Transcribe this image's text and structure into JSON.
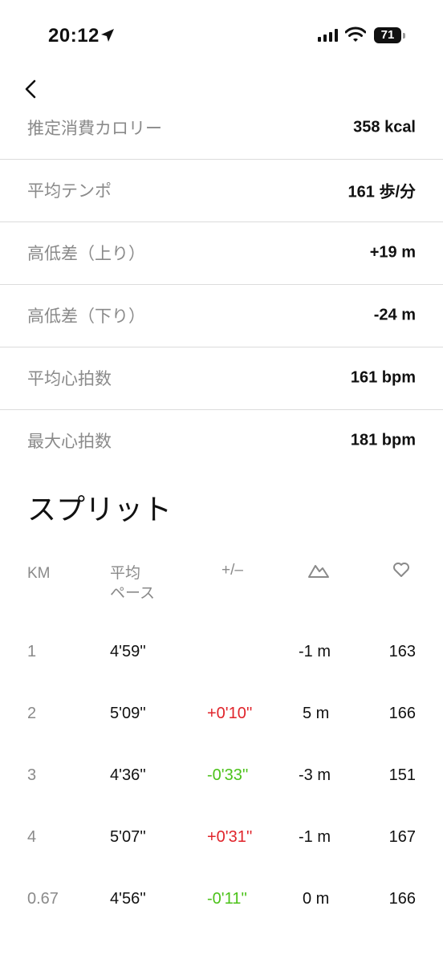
{
  "status_bar": {
    "time": "20:12",
    "battery": "71"
  },
  "stats": [
    {
      "label": "推定消費カロリー",
      "value": "358 kcal"
    },
    {
      "label": "平均テンポ",
      "value": "161 歩/分"
    },
    {
      "label": "高低差（上り）",
      "value": "+19 m"
    },
    {
      "label": "高低差（下り）",
      "value": "-24 m"
    },
    {
      "label": "平均心拍数",
      "value": "161 bpm"
    },
    {
      "label": "最大心拍数",
      "value": "181 bpm"
    }
  ],
  "splits": {
    "title": "スプリット",
    "headers": {
      "km": "KM",
      "pace_line1": "平均",
      "pace_line2": "ペース",
      "diff": "+/–",
      "elevation_icon": "mountain-icon",
      "heart_icon": "heart-icon"
    },
    "rows": [
      {
        "km": "1",
        "pace": "4'59''",
        "diff": "",
        "diff_color": "",
        "elevation": "-1 m",
        "heart_rate": "163"
      },
      {
        "km": "2",
        "pace": "5'09''",
        "diff": "+0'10''",
        "diff_color": "#e0242b",
        "elevation": "5 m",
        "heart_rate": "166"
      },
      {
        "km": "3",
        "pace": "4'36''",
        "diff": "-0'33''",
        "diff_color": "#4cc21a",
        "elevation": "-3 m",
        "heart_rate": "151"
      },
      {
        "km": "4",
        "pace": "5'07''",
        "diff": "+0'31''",
        "diff_color": "#e0242b",
        "elevation": "-1 m",
        "heart_rate": "167"
      },
      {
        "km": "0.67",
        "pace": "4'56''",
        "diff": "-0'11''",
        "diff_color": "#4cc21a",
        "elevation": "0 m",
        "heart_rate": "166"
      }
    ]
  }
}
